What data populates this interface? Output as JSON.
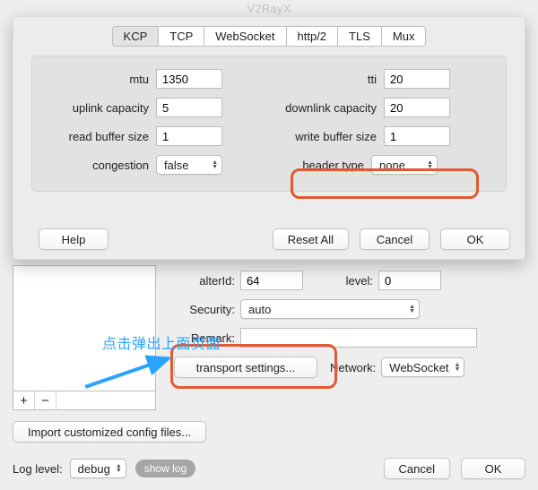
{
  "app_title": "V2RayX",
  "modal": {
    "tabs": [
      "KCP",
      "TCP",
      "WebSocket",
      "http/2",
      "TLS",
      "Mux"
    ],
    "selected_tab_index": 0,
    "fields": {
      "mtu": {
        "label": "mtu",
        "value": "1350"
      },
      "tti": {
        "label": "tti",
        "value": "20"
      },
      "uplink": {
        "label": "uplink capacity",
        "value": "5"
      },
      "downlink": {
        "label": "downlink capacity",
        "value": "20"
      },
      "read_buffer": {
        "label": "read buffer size",
        "value": "1"
      },
      "write_buffer": {
        "label": "write buffer size",
        "value": "1"
      },
      "congestion": {
        "label": "congestion",
        "value": "false"
      },
      "header_type": {
        "label": "header type",
        "value": "none"
      }
    },
    "buttons": {
      "help": "Help",
      "reset_all": "Reset All",
      "cancel": "Cancel",
      "ok": "OK"
    }
  },
  "lower": {
    "alterId": {
      "label": "alterId:",
      "value": "64"
    },
    "level": {
      "label": "level:",
      "value": "0"
    },
    "security": {
      "label": "Security:",
      "value": "auto"
    },
    "remark": {
      "label": "Remark:",
      "value": ""
    },
    "transport_button": "transport settings...",
    "network": {
      "label": "Network:",
      "value": "WebSocket"
    },
    "import_button": "Import customized config files...",
    "log_level": {
      "label": "Log level:",
      "value": "debug"
    },
    "show_log": "show log",
    "cancel": "Cancel",
    "ok": "OK"
  },
  "annotation": "点击弹出上面页面"
}
